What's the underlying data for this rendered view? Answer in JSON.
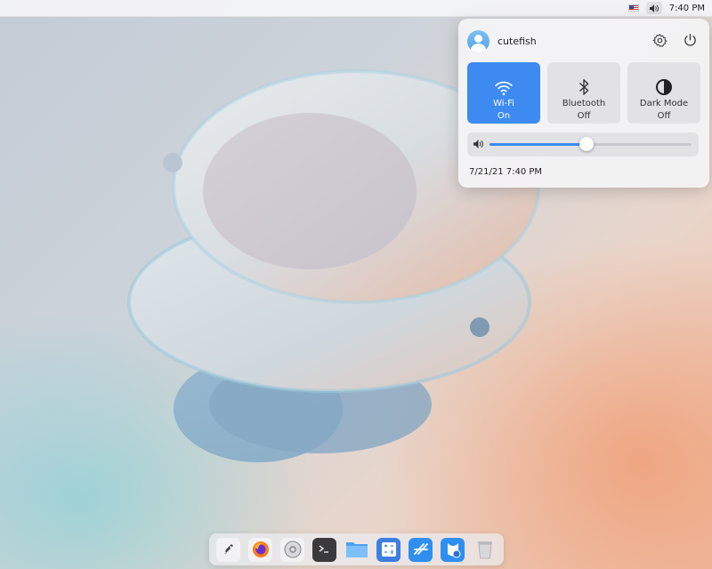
{
  "topbar": {
    "flag_icon": "us-flag-icon",
    "volume_icon": "speaker-icon",
    "clock": "7:40 PM"
  },
  "panel": {
    "username": "cutefish",
    "tiles": [
      {
        "name": "Wi-Fi",
        "state": "On",
        "icon": "wifi-icon",
        "active": true
      },
      {
        "name": "Bluetooth",
        "state": "Off",
        "icon": "bluetooth-icon",
        "active": false
      },
      {
        "name": "Dark Mode",
        "state": "Off",
        "icon": "dark-mode-icon",
        "active": false
      }
    ],
    "volume_level": 0.48,
    "datetime": "7/21/21 7:40 PM",
    "accent": "#3d8bf0"
  },
  "dock": {
    "items": [
      "launcher-icon",
      "firefox-icon",
      "settings-icon",
      "terminal-icon",
      "files-icon",
      "calculator-icon",
      "app-store-icon",
      "cutefish-icon",
      "trash-icon"
    ]
  }
}
